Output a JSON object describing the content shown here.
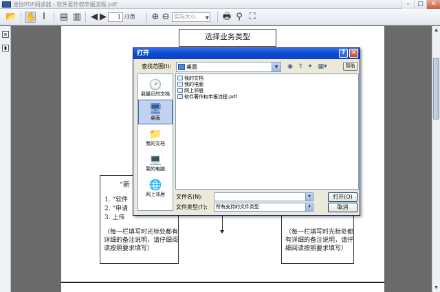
{
  "app": {
    "title": "迷你PDF阅读器 - 软件著作权申报流程.pdf",
    "minimize": "–",
    "maximize": "□",
    "close": "✕"
  },
  "toolbar": {
    "current_page": "1",
    "total_pages": "/3页",
    "zoom": "实际大小"
  },
  "document": {
    "top_box": "选择业务类型",
    "left_box": {
      "title": "“新",
      "lines": [
        "1.  “软件",
        "2.  “申请",
        "3.  上传"
      ],
      "note": "（每一栏填写时光标处都有详细的备注说明，请仔细阅读按照要求填写）"
    },
    "right_box": {
      "note": "（每一栏填写时光标处都有详细的备注说明，请仔细阅读按照要求填写）"
    }
  },
  "dialog": {
    "title": "打开",
    "help": "?",
    "close": "✕",
    "look_in_label": "查找范围(I):",
    "look_in_value": "桌面",
    "utils_label": "帮助",
    "places": [
      {
        "label": "我最近的文档",
        "icon": "recent-documents-icon"
      },
      {
        "label": "桌面",
        "icon": "desktop-icon"
      },
      {
        "label": "我的文档",
        "icon": "my-documents-icon"
      },
      {
        "label": "我的电脑",
        "icon": "my-computer-icon"
      },
      {
        "label": "网上邻居",
        "icon": "network-places-icon"
      }
    ],
    "files": [
      {
        "name": "我的文档",
        "icon": "folder-icon"
      },
      {
        "name": "我的电脑",
        "icon": "computer-icon"
      },
      {
        "name": "网上邻居",
        "icon": "network-icon"
      },
      {
        "name": "软件著作权申报流程.pdf",
        "icon": "pdf-file-icon"
      }
    ],
    "file_name_label": "文件名(N):",
    "file_name_value": "",
    "file_type_label": "文件类型(T):",
    "file_type_value": "所有支持的文件类型",
    "open_button": "打开(O)",
    "cancel_button": "取消"
  }
}
